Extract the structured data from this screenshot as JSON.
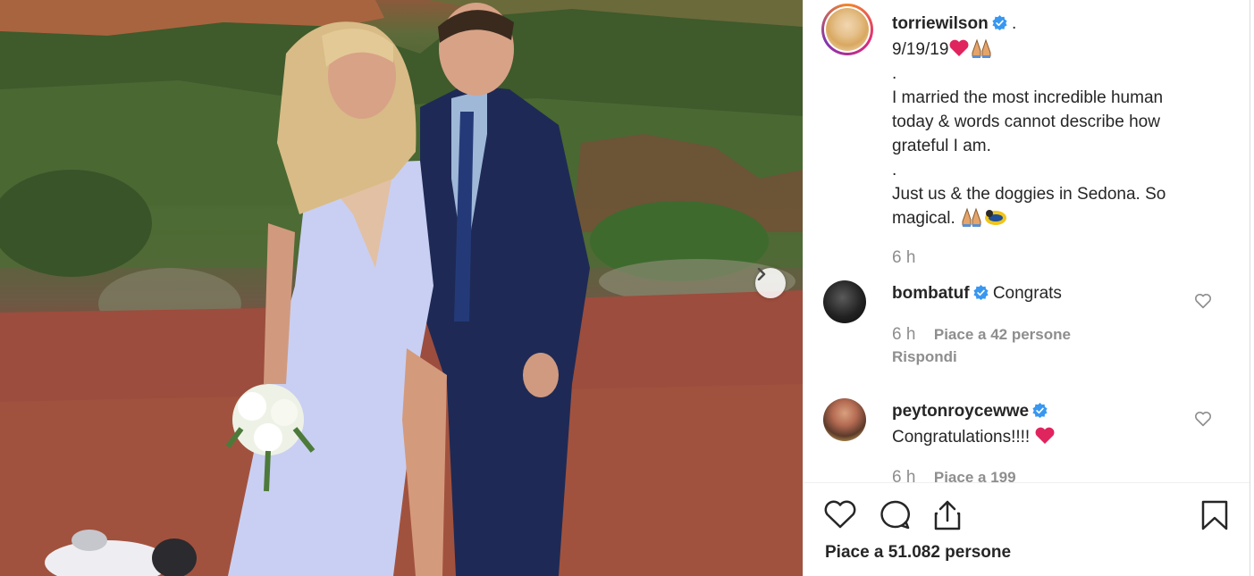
{
  "post": {
    "author": "torriewilson",
    "author_suffix": ".",
    "caption_lines": [
      "9/19/19",
      ".",
      "I married the most incredible human",
      "today & words cannot describe how",
      "grateful I am.",
      ".",
      "Just us & the doggies in Sedona. So",
      "magical."
    ],
    "time": "6 h",
    "likes_text": "Piace a 51.082 persone"
  },
  "comments": [
    {
      "username": "bombatuf",
      "text": "Congrats",
      "time": "6 h",
      "likes": "Piace a 42 persone",
      "reply": "Rispondi"
    },
    {
      "username": "peytonroycewwe",
      "text": "Congratulations!!!!",
      "time": "6 h",
      "likes": "Piace a 199"
    }
  ],
  "icons": {
    "verified": "verified-badge-icon",
    "heart": "heart-icon",
    "comment": "comment-icon",
    "share": "share-icon",
    "save": "bookmark-icon",
    "next": "chevron-right-icon",
    "prayer": "folded-hands-emoji",
    "dog_emoji": "guide-dog-emoji"
  },
  "colors": {
    "verified": "#3897f0",
    "red_heart": "#e0245e",
    "meta_gray": "#8e8e8e"
  }
}
